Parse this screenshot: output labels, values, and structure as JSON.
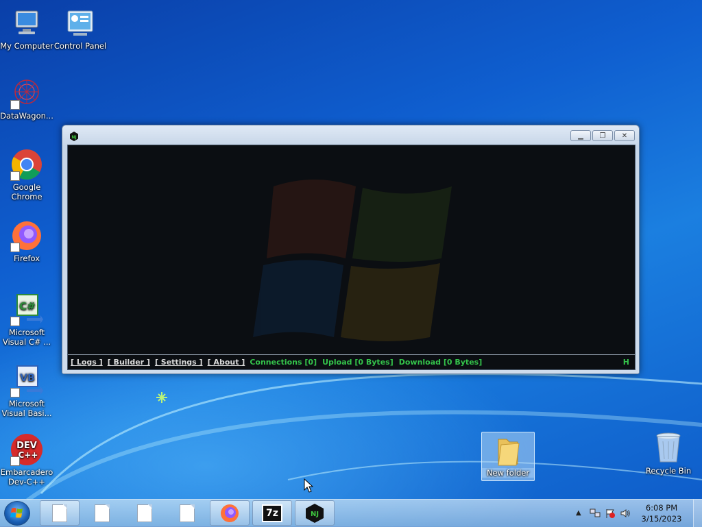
{
  "desktop": {
    "icons": [
      {
        "label": "My Computer"
      },
      {
        "label": "Control Panel"
      },
      {
        "label": "DataWagon..."
      },
      {
        "label": "Google Chrome"
      },
      {
        "label": "Firefox"
      },
      {
        "label": "Microsoft Visual C# ..."
      },
      {
        "label": "Microsoft Visual Basi..."
      },
      {
        "label": "Embarcadero Dev-C++"
      },
      {
        "label": "New folder"
      },
      {
        "label": "Recycle Bin"
      }
    ]
  },
  "rat_window": {
    "menu": {
      "logs": "[ Logs ]",
      "builder": "[ Builder ]",
      "settings": "[ Settings ]",
      "about": "[ About ]"
    },
    "status": {
      "connections": "Connections [0]",
      "upload": "Upload [0 Bytes]",
      "download": "Download [0 Bytes]",
      "hidden_toggle": "H"
    }
  },
  "taskbar": {
    "buttons": [
      {
        "icon": "document-icon"
      },
      {
        "icon": "document-icon"
      },
      {
        "icon": "document-icon"
      },
      {
        "icon": "document-icon"
      },
      {
        "icon": "firefox-icon"
      },
      {
        "icon": "7zip-icon",
        "text": "7z"
      },
      {
        "icon": "njrat-icon",
        "text": "NJ"
      }
    ],
    "clock": {
      "time": "6:08 PM",
      "date": "3/15/2023"
    }
  },
  "colors": {
    "status_green": "#34c24a",
    "window_client": "#0b0e12"
  }
}
